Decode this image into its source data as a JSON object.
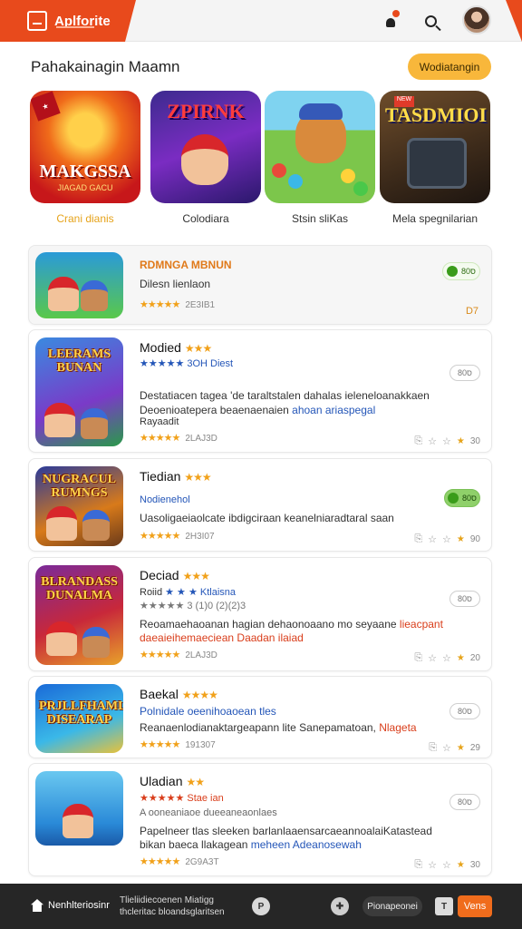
{
  "app": {
    "brand": "Aplforite"
  },
  "header": {
    "icons": [
      "bell-icon",
      "search-icon",
      "avatar"
    ]
  },
  "featured": {
    "title": "Pahakainagin Maamn",
    "button": "Wodiatangin",
    "tiles": [
      {
        "art_title": "MAKGSSA",
        "art_sub": "JIAGAD GACU",
        "label": "Crani dianis",
        "label_color": "#e6a31a"
      },
      {
        "art_title": "ZPIRNK",
        "label": "Colodiara",
        "label_color": "#333333"
      },
      {
        "label": "Stsin sliKas",
        "label_color": "#333333"
      },
      {
        "art_title": "TASDMIOI",
        "label": "Mela spegnilarian",
        "label_color": "#333333"
      }
    ]
  },
  "list": [
    {
      "title": "RDMNGA MBNUN",
      "line1": "Dilesn lienlaon",
      "rating": "★★★★★",
      "rating_num": "2E3IB1",
      "pill": "ס80",
      "corner": "D7"
    },
    {
      "title": "Modied",
      "title_stars": "★★★",
      "thumb_title": "LEERAMS BUNAN",
      "line1": "★★★★★ 3OH Diest",
      "line2": "Destatiacen tagea 'de taraltstalen dahalas ieleneloanakkaen",
      "line3a": "Deoenioatepera beaenaenaien ",
      "line3b": "ahoan ariaspegal",
      "line4": "Rayaadit",
      "rating": "★★★★★",
      "rating_num": "2LAJ3D",
      "pill": "ס80",
      "metas": {
        "a": "30"
      }
    },
    {
      "title": "Tiedian",
      "title_stars": "★★★",
      "thumb_title": "NUGRACUL RUMNGS",
      "line1": "Nodienehol",
      "line2": "Uasoligaeiaolcate ibdigciraan keanelniaradtaral saan",
      "rating": "★★★★★",
      "rating_num": "2H3I07",
      "pill": "ס80",
      "metas": {
        "a": "90"
      }
    },
    {
      "title": "Deciad",
      "title_stars": "★★★",
      "thumb_title": "BLRANDASS DUNALMA",
      "line1a": "Roiid ",
      "line1b": "★ ★ ★ Ktlaisna",
      "line2": "★★★★★ 3 (1)0 (2)(2)3",
      "line3": "Reoamaehaoanan hagian dehaonoaano mo seyaane ",
      "line3b": "lieacpant",
      "line4": "daeaieihemaeciean Daadan ilaiad",
      "rating": "★★★★★",
      "rating_num": "2LAJ3D",
      "pill": "ס80",
      "metas": {
        "a": "20"
      }
    },
    {
      "title": "Baekal",
      "title_stars": "★★★★",
      "thumb_title": "PRJLLFHAML DISEARAP",
      "line1": "Polnidale oeenihoaoean tles",
      "line2": "Reanaenlodianaktargeapann lite Sanepamatoan, ",
      "line2b": "Nlageta",
      "rating": "★★★★★",
      "rating_num": "191307",
      "pill": "ס80",
      "metas": {
        "a": "29"
      }
    },
    {
      "title": "Uladian",
      "title_stars": "★★",
      "line1": "★★★★★ Stae ian",
      "line2": "A ooneaniaoe dueeaneaonlaes",
      "line3": "Papelneer tlas sleeken barlanlaaensarcaeannoalaiKatastead",
      "line4a": "bikan baeca llakagean ",
      "line4b": "meheen Adeanosewah",
      "rating": "★★★★★",
      "rating_num": "2G9A3T",
      "pill": "ס80",
      "metas": {
        "a": "30"
      }
    }
  ],
  "bottom": {
    "home": "Nenhlteriosinr",
    "desc": "Tlieliidiecoenen Miatigg thcleritac bloandsglaritsen",
    "circle1": "P",
    "pill": "Pionapeonei",
    "square": "T",
    "cta": "Vens"
  }
}
